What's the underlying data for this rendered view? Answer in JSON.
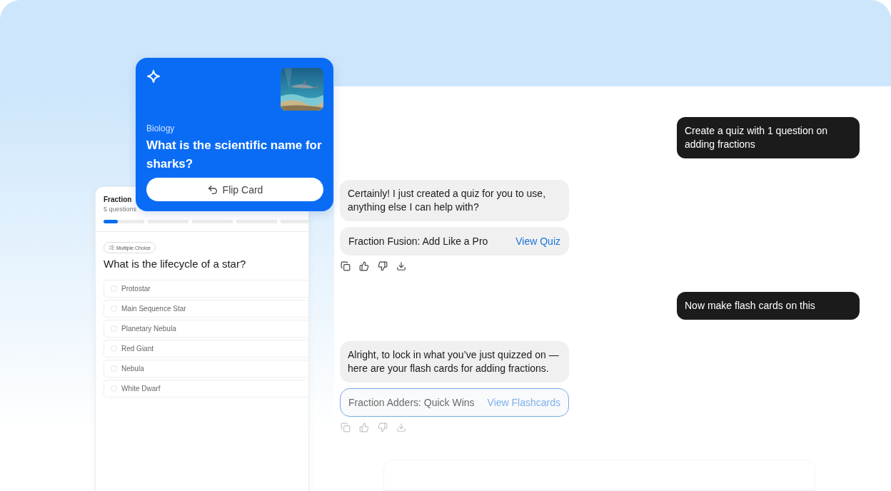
{
  "flashcard": {
    "subject": "Biology",
    "question": "What is the scientific name for sharks?",
    "flip_button": "Flip Card"
  },
  "quiz": {
    "title": "Fraction",
    "subtitle": "5 questions",
    "progress": {
      "level": 0.065
    },
    "tag": "Multiple Choice",
    "question": "What is the lifecycle of a star?",
    "options": [
      {
        "label": "Protostar",
        "selected": false
      },
      {
        "label": "Main Sequence Star",
        "selected": false
      },
      {
        "label": "Planetary Nebula",
        "selected": false
      },
      {
        "label": "Red Giant",
        "selected": false
      },
      {
        "label": "Nebula",
        "selected": false
      },
      {
        "label": "White Dwarf",
        "selected": false
      }
    ]
  },
  "chat": [
    {
      "kind": "user",
      "text": "Create a quiz with 1 question on adding fractions"
    },
    {
      "kind": "assistant",
      "text": "Certainly! I just created a quiz for you to use, anything else I can help with?",
      "attachment": {
        "title": "Fraction Fusion: Add Like a Pro",
        "action": "View Quiz",
        "highlighted": false
      },
      "dimmed": false
    },
    {
      "kind": "user",
      "text": "Now make flash cards on this"
    },
    {
      "kind": "assistant",
      "text": "Alright, to lock in what you’ve just quizzed on — here are your flash cards for adding fractions.",
      "attachment": {
        "title": "Fraction Adders: Quick Wins",
        "action": "View Flashcards",
        "highlighted": true
      },
      "dimmed": true
    }
  ]
}
